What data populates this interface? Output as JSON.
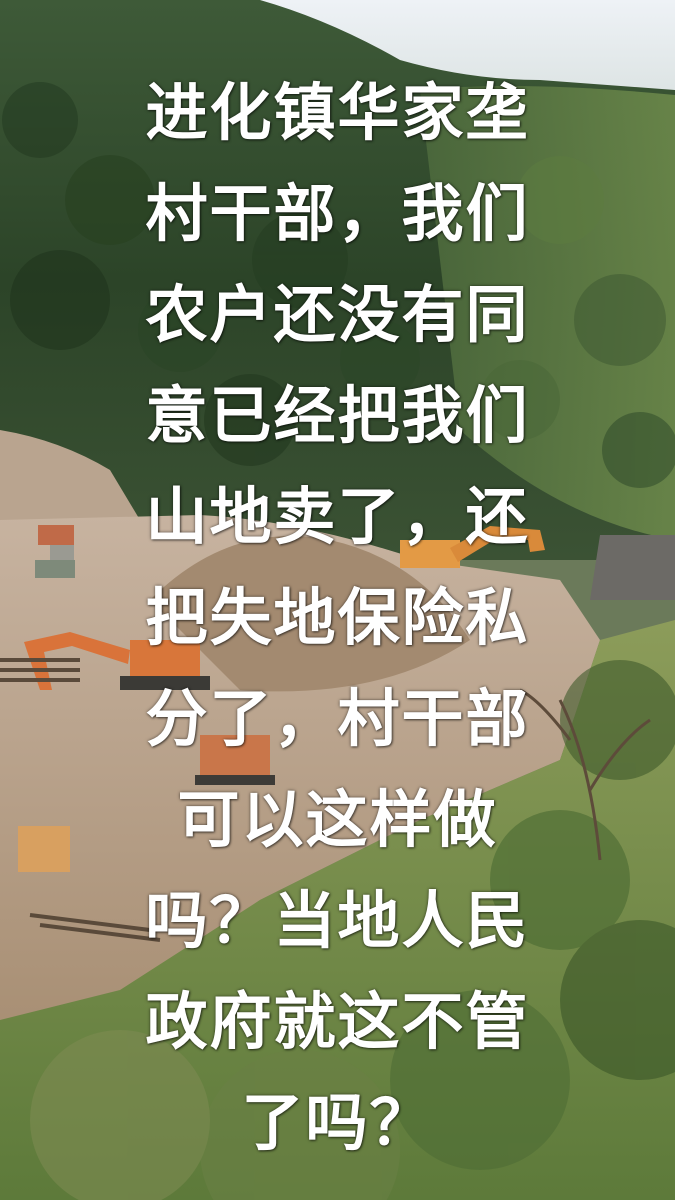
{
  "caption": {
    "lines": [
      "进化镇华家垄",
      "村干部，我们",
      "农户还没有同",
      "意已经把我们",
      "山地卖了，还",
      "把失地保险私",
      "分了，村干部",
      "可以这样做",
      "吗？当地人民",
      "政府就这不管",
      "了吗？"
    ]
  },
  "colors": {
    "caption_text": "#ffffff",
    "sky": "#dfe6ee",
    "forest": "#2f4a2a",
    "dirt": "#b79f86",
    "excavator": "#e07a3a"
  }
}
